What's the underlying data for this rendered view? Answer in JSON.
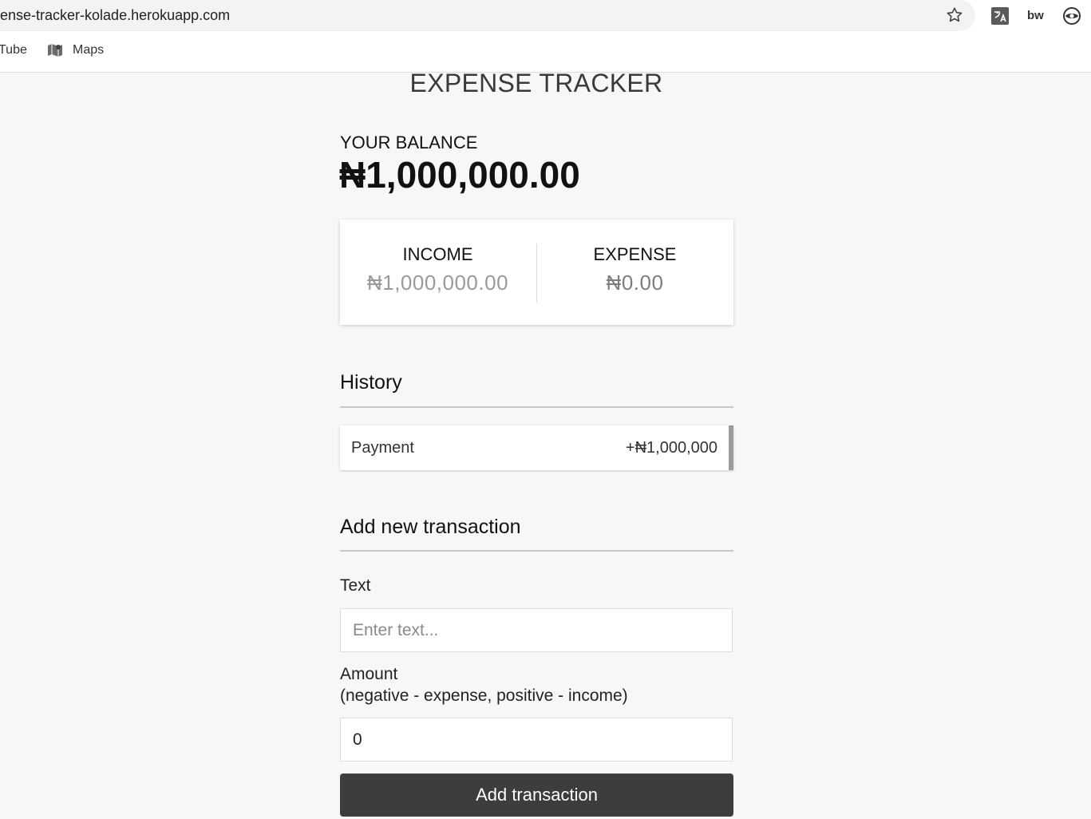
{
  "browser": {
    "url": "ense-tracker-kolade.herokuapp.com",
    "bookmarks": [
      {
        "label": "Tube"
      },
      {
        "label": "Maps",
        "icon": "maps-icon"
      }
    ],
    "extensions": {
      "bw_label": "bw"
    }
  },
  "app": {
    "title": "EXPENSE TRACKER",
    "balance_label": "YOUR BALANCE",
    "balance_value": "₦1,000,000.00",
    "income": {
      "label": "INCOME",
      "value": "₦1,000,000.00"
    },
    "expense": {
      "label": "EXPENSE",
      "value": "₦0.00"
    },
    "history": {
      "title": "History",
      "items": [
        {
          "text": "Payment",
          "amount": "+₦1,000,000"
        }
      ]
    },
    "form": {
      "title": "Add new transaction",
      "text_label": "Text",
      "text_placeholder": "Enter text...",
      "amount_label": "Amount",
      "amount_hint": "(negative - expense, positive - income)",
      "amount_value": "0",
      "submit_label": "Add transaction"
    }
  },
  "colors": {
    "page_bg": "#f7f7f7",
    "button_bg": "#3d3d3d",
    "history_border": "#9b9b9b"
  }
}
